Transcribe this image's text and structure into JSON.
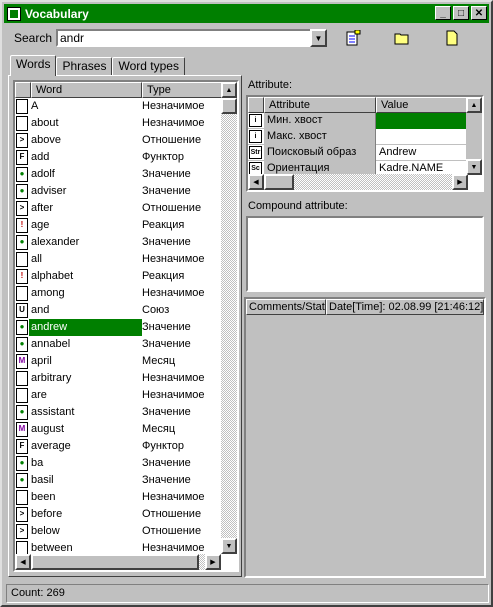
{
  "window": {
    "title": "Vocabulary"
  },
  "toolbar": {
    "search_label": "Search",
    "search_value": "andr"
  },
  "tabs": [
    {
      "label": "Words",
      "active": true
    },
    {
      "label": "Phrases",
      "active": false
    },
    {
      "label": "Word types",
      "active": false
    }
  ],
  "word_list": {
    "columns": [
      "Word",
      "Type"
    ],
    "rows": [
      {
        "word": "A",
        "type": "Незначимое",
        "icon": "doc-icon"
      },
      {
        "word": "about",
        "type": "Незначимое",
        "icon": "doc-icon"
      },
      {
        "word": "above",
        "type": "Отношение",
        "icon": "relation-icon"
      },
      {
        "word": "add",
        "type": "Функтор",
        "icon": "functor-icon"
      },
      {
        "word": "adolf",
        "type": "Значение",
        "icon": "value-icon"
      },
      {
        "word": "adviser",
        "type": "Значение",
        "icon": "value-icon"
      },
      {
        "word": "after",
        "type": "Отношение",
        "icon": "relation-icon"
      },
      {
        "word": "age",
        "type": "Реакция",
        "icon": "reaction-icon"
      },
      {
        "word": "alexander",
        "type": "Значение",
        "icon": "value-icon"
      },
      {
        "word": "all",
        "type": "Незначимое",
        "icon": "doc-icon"
      },
      {
        "word": "alphabet",
        "type": "Реакция",
        "icon": "reaction-icon"
      },
      {
        "word": "among",
        "type": "Незначимое",
        "icon": "doc-icon"
      },
      {
        "word": "and",
        "type": "Союз",
        "icon": "union-icon"
      },
      {
        "word": "andrew",
        "type": "Значение",
        "icon": "value-icon",
        "selected": true
      },
      {
        "word": "annabel",
        "type": "Значение",
        "icon": "value-icon"
      },
      {
        "word": "april",
        "type": "Месяц",
        "icon": "month-icon"
      },
      {
        "word": "arbitrary",
        "type": "Незначимое",
        "icon": "doc-icon"
      },
      {
        "word": "are",
        "type": "Незначимое",
        "icon": "doc-icon"
      },
      {
        "word": "assistant",
        "type": "Значение",
        "icon": "value-icon"
      },
      {
        "word": "august",
        "type": "Месяц",
        "icon": "month-icon"
      },
      {
        "word": "average",
        "type": "Функтор",
        "icon": "functor-icon"
      },
      {
        "word": "ba",
        "type": "Значение",
        "icon": "value-icon"
      },
      {
        "word": "basil",
        "type": "Значение",
        "icon": "value-icon"
      },
      {
        "word": "been",
        "type": "Незначимое",
        "icon": "doc-icon"
      },
      {
        "word": "before",
        "type": "Отношение",
        "icon": "relation-icon"
      },
      {
        "word": "below",
        "type": "Отношение",
        "icon": "relation-icon"
      },
      {
        "word": "between",
        "type": "Незначимое",
        "icon": "doc-icon"
      }
    ]
  },
  "attribute": {
    "label": "Attribute:",
    "columns": [
      "Attribute",
      "Value"
    ],
    "rows": [
      {
        "icon": "i",
        "name": "Мин. хвост",
        "value": "",
        "selected": true
      },
      {
        "icon": "i",
        "name": "Макс. хвост",
        "value": ""
      },
      {
        "icon": "Str",
        "name": "Поисковый образ",
        "value": "Andrew"
      },
      {
        "icon": "Sc",
        "name": "Ориентация",
        "value": "Kadre.NAME"
      }
    ]
  },
  "compound": {
    "label": "Compound attribute:"
  },
  "comments": {
    "comments_header": "Comments/Statu",
    "date_header": "Date[Time]: 02.08.99 [21:46:12]"
  },
  "status": {
    "text": "Count: 269"
  },
  "colors": {
    "accent": "#007f00",
    "face": "#c0c0c0"
  }
}
